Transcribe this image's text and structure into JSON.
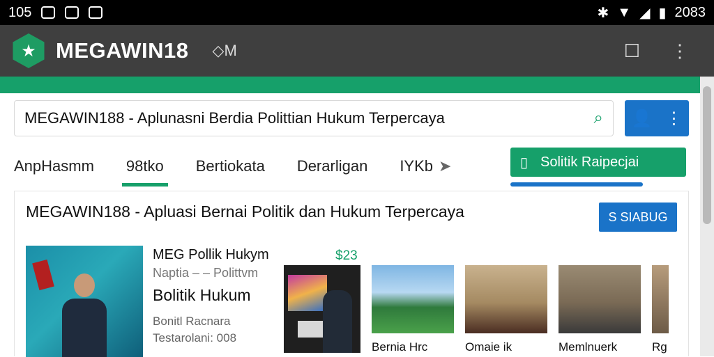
{
  "status_bar": {
    "time": "105",
    "right": "2083"
  },
  "app_bar": {
    "title": "MEGAWIN18",
    "subtitle": "◇M",
    "logo": "star-logo"
  },
  "search": {
    "value": "MEGAWIN188 - Aplunasni Berdia Polittian Hukum Terpercaya"
  },
  "tabs": [
    "AnpHasmm",
    "98tko",
    "Bertiokata",
    "Derarligan",
    "IYKb"
  ],
  "cta": {
    "label": "Solitik Raipecjai"
  },
  "card": {
    "title": "MEGAWIN188 - Apluasi Bernai Politik dan Hukum Terpercaya",
    "button": "S SIABUG",
    "news": {
      "headline": "MEG Pollik Hukym",
      "sub": "Naptia – – Polittvm",
      "big": "Bolitik Hukum",
      "meta1": "Bonitl Racnara",
      "meta2": "Testarolani: 008",
      "price": "$23"
    },
    "thumbs": [
      {
        "caption": "Bernia Hrc"
      },
      {
        "caption": "Omaie ik"
      },
      {
        "caption": "Memlnuerk"
      },
      {
        "caption": "Rg"
      }
    ]
  },
  "colors": {
    "accent": "#16a06a",
    "primary": "#1a73c8"
  }
}
